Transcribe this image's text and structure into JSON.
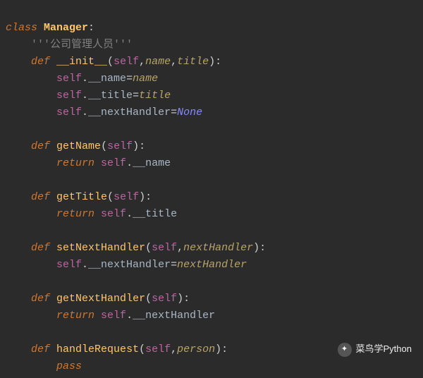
{
  "class_kw": "class",
  "class_name": "Manager",
  "colon": ":",
  "docstring": "'''公司管理人员'''",
  "def_kw": "def",
  "return_kw": "return",
  "pass_kw": "pass",
  "none_kw": "None",
  "methods": {
    "init": {
      "name": "__init__",
      "params": {
        "self": "self",
        "name": "name",
        "title": "title"
      },
      "body": {
        "l1_self": "self",
        "l1_attr": "__name",
        "l1_val": "name",
        "l2_self": "self",
        "l2_attr": "__title",
        "l2_val": "title",
        "l3_self": "self",
        "l3_attr": "__nextHandler"
      }
    },
    "getName": {
      "name": "getName",
      "params": {
        "self": "self"
      },
      "body": {
        "self": "self",
        "attr": "__name"
      }
    },
    "getTitle": {
      "name": "getTitle",
      "params": {
        "self": "self"
      },
      "body": {
        "self": "self",
        "attr": "__title"
      }
    },
    "setNextHandler": {
      "name": "setNextHandler",
      "params": {
        "self": "self",
        "nextHandler": "nextHandler"
      },
      "body": {
        "self": "self",
        "attr": "__nextHandler",
        "val": "nextHandler"
      }
    },
    "getNextHandler": {
      "name": "getNextHandler",
      "params": {
        "self": "self"
      },
      "body": {
        "self": "self",
        "attr": "__nextHandler"
      }
    },
    "handleRequest": {
      "name": "handleRequest",
      "params": {
        "self": "self",
        "person": "person"
      }
    }
  },
  "watermark": {
    "icon_label": "wx",
    "text": "菜鸟学Python"
  }
}
